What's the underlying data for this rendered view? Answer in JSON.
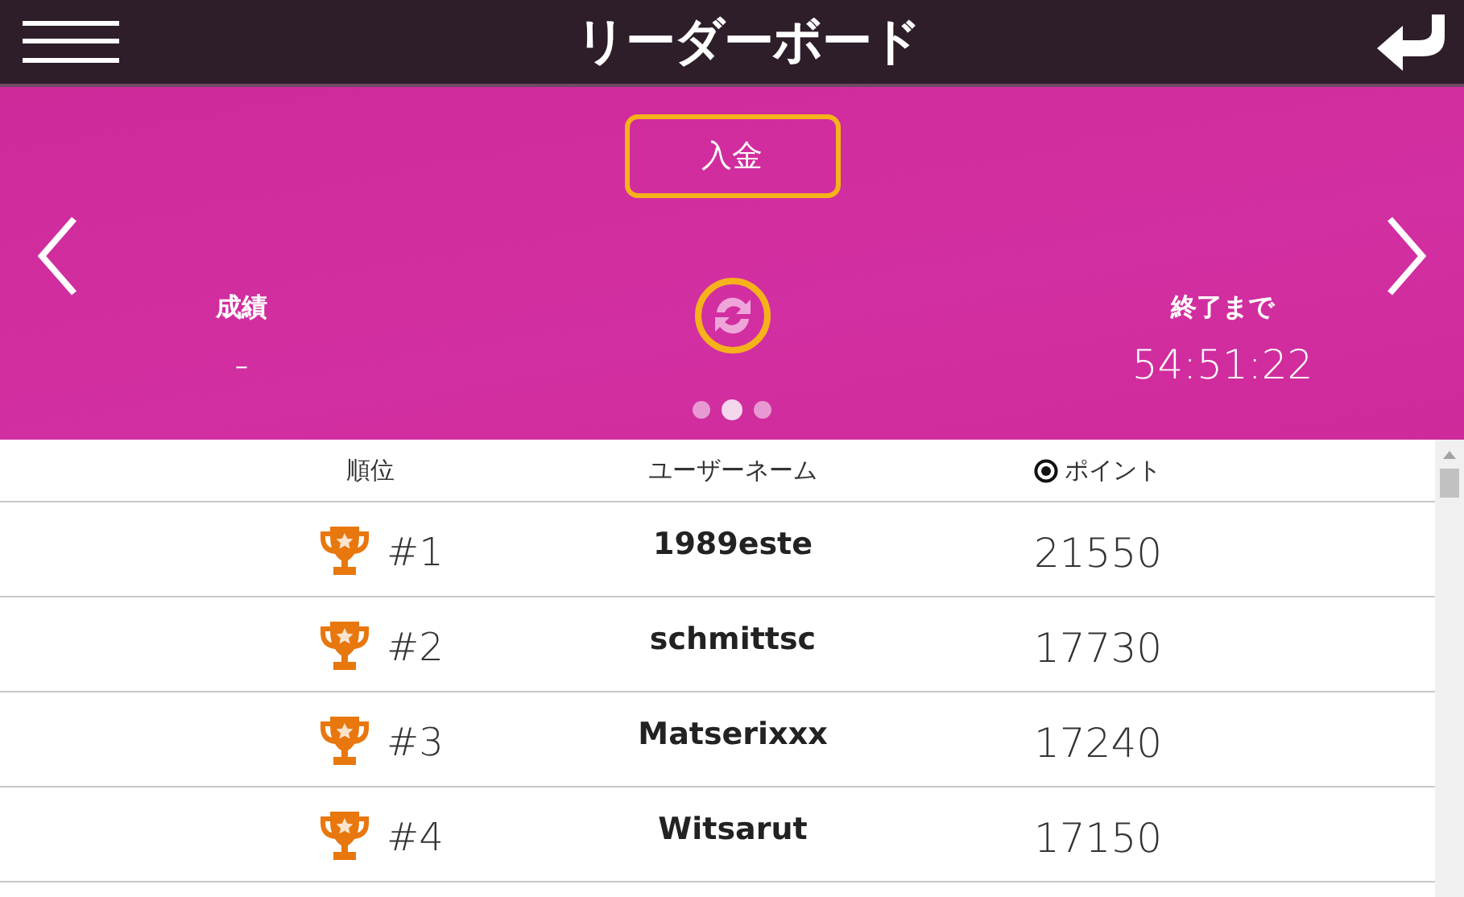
{
  "header": {
    "title": "リーダーボード"
  },
  "banner": {
    "deposit_button": "入金",
    "stats": [
      {
        "label": "成績",
        "value": "-"
      },
      {
        "label": "終了まで",
        "value": "54:51:22"
      }
    ],
    "dots": [
      {
        "selected": false
      },
      {
        "selected": true
      },
      {
        "selected": false
      }
    ]
  },
  "table": {
    "columns": [
      "順位",
      "ユーザーネーム",
      "ポイント"
    ],
    "rows": [
      {
        "rank": "#1",
        "username": "1989este",
        "points": "21550"
      },
      {
        "rank": "#2",
        "username": "schmittsc",
        "points": "17730"
      },
      {
        "rank": "#3",
        "username": "Matserixxx",
        "points": "17240"
      },
      {
        "rank": "#4",
        "username": "Witsarut",
        "points": "17150"
      }
    ]
  }
}
